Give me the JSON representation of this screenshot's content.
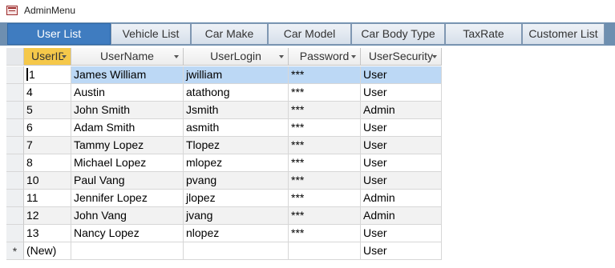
{
  "window": {
    "title": "AdminMenu"
  },
  "tabs": [
    {
      "label": "User List",
      "active": true
    },
    {
      "label": "Vehicle List",
      "active": false
    },
    {
      "label": "Car Make",
      "active": false
    },
    {
      "label": "Car Model",
      "active": false
    },
    {
      "label": "Car Body Type",
      "active": false
    },
    {
      "label": "TaxRate",
      "active": false
    },
    {
      "label": "Customer List",
      "active": false
    }
  ],
  "grid": {
    "columns": [
      "UserID",
      "UserName",
      "UserLogin",
      "Password",
      "UserSecurity"
    ],
    "column_display": [
      "UserID",
      "UserName",
      "UserLogin",
      "Password",
      "UserSecurity"
    ],
    "rows": [
      {
        "id": "1",
        "name": "James William",
        "login": "jwilliam",
        "password": "***",
        "security": "User"
      },
      {
        "id": "4",
        "name": "Austin",
        "login": "atathong",
        "password": "***",
        "security": "User"
      },
      {
        "id": "5",
        "name": "John Smith",
        "login": "Jsmith",
        "password": "***",
        "security": "Admin"
      },
      {
        "id": "6",
        "name": "Adam Smith",
        "login": "asmith",
        "password": "***",
        "security": "User"
      },
      {
        "id": "7",
        "name": "Tammy Lopez",
        "login": "Tlopez",
        "password": "***",
        "security": "User"
      },
      {
        "id": "8",
        "name": "Michael Lopez",
        "login": "mlopez",
        "password": "***",
        "security": "User"
      },
      {
        "id": "10",
        "name": "Paul Vang",
        "login": "pvang",
        "password": "***",
        "security": "User"
      },
      {
        "id": "11",
        "name": "Jennifer Lopez",
        "login": "jlopez",
        "password": "***",
        "security": "Admin"
      },
      {
        "id": "12",
        "name": "John Vang",
        "login": "jvang",
        "password": "***",
        "security": "Admin"
      },
      {
        "id": "13",
        "name": "Nancy Lopez",
        "login": "nlopez",
        "password": "***",
        "security": "User"
      }
    ],
    "new_row": {
      "marker": "*",
      "id": "(New)",
      "security": "User"
    }
  },
  "colors": {
    "active_tab": "#3f7cc0",
    "sorted_header": "#f5c84a",
    "selected_row": "#bcd8f5"
  }
}
